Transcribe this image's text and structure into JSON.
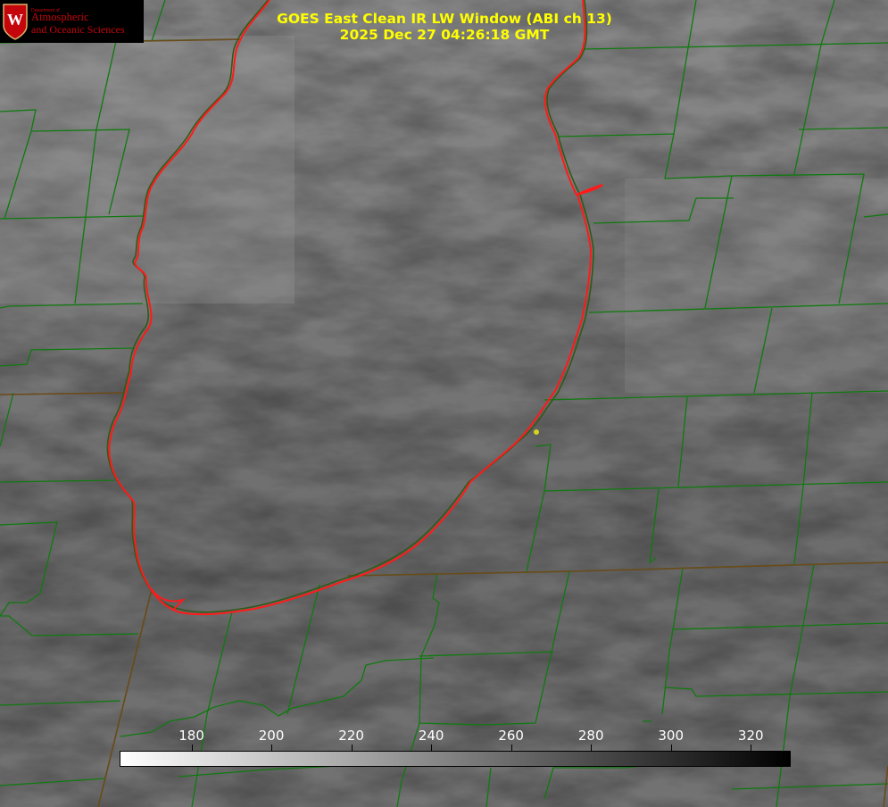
{
  "header": {
    "title_line1": "GOES East Clean IR LW Window (ABI ch 13)",
    "title_line2": "2025 Dec 27 04:26:18 GMT"
  },
  "logo": {
    "department": "Department of",
    "line1": "Atmospheric",
    "line2": "and Oceanic Sciences",
    "seal_letter": "W"
  },
  "colorbar": {
    "tick_labels": [
      "180",
      "200",
      "220",
      "240",
      "260",
      "280",
      "300",
      "320"
    ],
    "range": [
      162,
      330
    ],
    "colors": {
      "low": "#ffffff",
      "high": "#000000"
    }
  },
  "overlay": {
    "county_line_color": "#0f7a0f",
    "lake_outline_color": "#ff1a1a",
    "title_color": "#ffff00",
    "station_color": "#d6d21f"
  }
}
